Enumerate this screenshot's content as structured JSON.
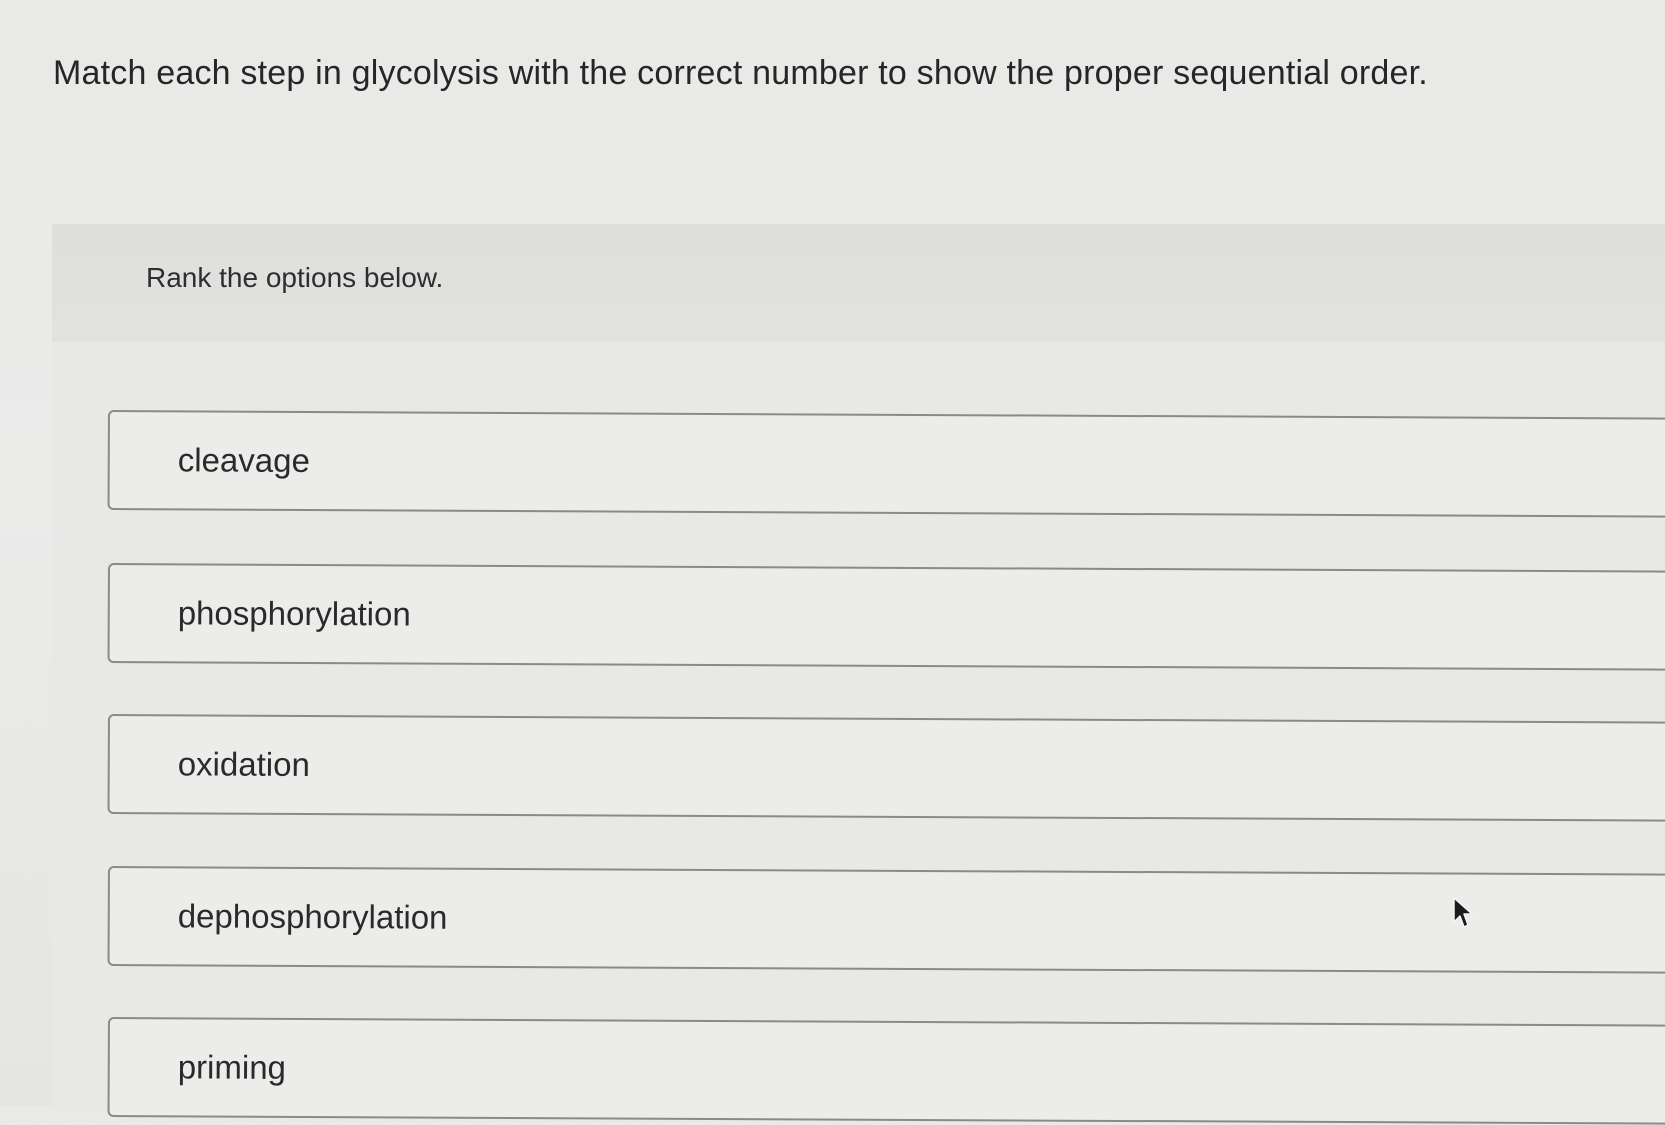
{
  "question": {
    "text": "Match each step in glycolysis with the correct number to show the proper sequential order."
  },
  "ranking": {
    "instruction": "Rank the options below.",
    "options": [
      {
        "label": "cleavage"
      },
      {
        "label": "phosphorylation"
      },
      {
        "label": "oxidation"
      },
      {
        "label": "dephosphorylation"
      },
      {
        "label": "priming"
      }
    ]
  },
  "cursor": {
    "icon": "mouse-pointer-icon"
  }
}
